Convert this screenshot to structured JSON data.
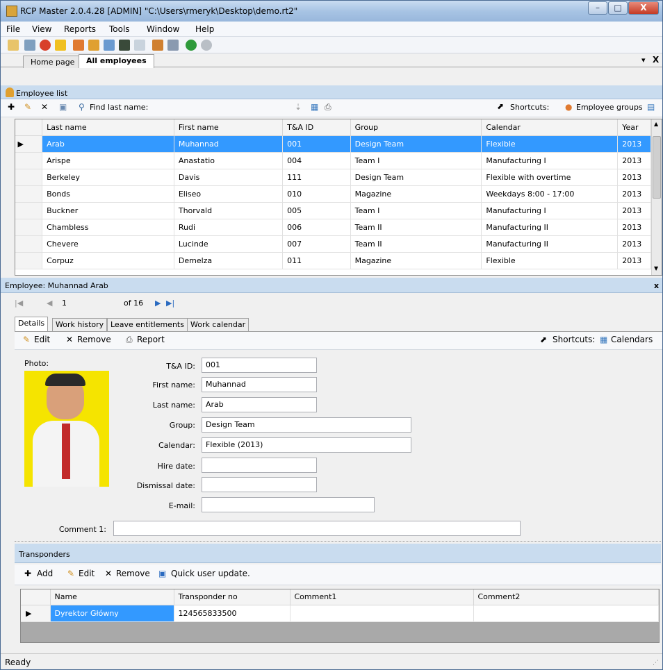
{
  "window": {
    "title": "RCP Master 2.0.4.28  [ADMIN] \"C:\\Users\\rmeryk\\Desktop\\demo.rt2\"",
    "minimize": "–",
    "maximize": "□",
    "close": "X"
  },
  "menu": [
    "File",
    "View",
    "Reports",
    "Tools",
    "Window",
    "Help"
  ],
  "page_tabs": {
    "home": "Home page",
    "active": "All employees",
    "pin": "▾",
    "close": "X"
  },
  "employee_list": {
    "header": "Employee list",
    "find_label": "Find last name:",
    "shortcuts_label": "Shortcuts:",
    "shortcut_link": "Employee groups",
    "columns": [
      "Last name",
      "First name",
      "T&A ID",
      "Group",
      "Calendar",
      "Year"
    ],
    "rows": [
      [
        "Arab",
        "Muhannad",
        "001",
        "Design Team",
        "Flexible",
        "2013"
      ],
      [
        "Arispe",
        "Anastatio",
        "004",
        "Team I",
        "Manufacturing I",
        "2013"
      ],
      [
        "Berkeley",
        "Davis",
        "111",
        "Design Team",
        "Flexible with overtime",
        "2013"
      ],
      [
        "Bonds",
        "Eliseo",
        "010",
        "Magazine",
        "Weekdays 8:00 - 17:00",
        "2013"
      ],
      [
        "Buckner",
        "Thorvald",
        "005",
        "Team I",
        "Manufacturing I",
        "2013"
      ],
      [
        "Chambless",
        "Rudi",
        "006",
        "Team II",
        "Manufacturing II",
        "2013"
      ],
      [
        "Chevere",
        "Lucinde",
        "007",
        "Team II",
        "Manufacturing II",
        "2013"
      ],
      [
        "Corpuz",
        "Demelza",
        "011",
        "Magazine",
        "Flexible",
        "2013"
      ]
    ]
  },
  "employee_detail": {
    "header": "Employee: Muhannad Arab",
    "close": "x",
    "nav_position": "1",
    "nav_total": "of 16",
    "tabs": [
      "Details",
      "Work history",
      "Leave entitlements",
      "Work calendar"
    ],
    "toolbar": {
      "edit": "Edit",
      "remove": "Remove",
      "report": "Report",
      "shortcuts": "Shortcuts:",
      "calendars": "Calendars"
    },
    "photo_label": "Photo:",
    "fields": {
      "ta_id_label": "T&A ID:",
      "ta_id": "001",
      "first_label": "First name:",
      "first": "Muhannad",
      "last_label": "Last name:",
      "last": "Arab",
      "group_label": "Group:",
      "group": "Design Team",
      "calendar_label": "Calendar:",
      "calendar": "Flexible  (2013)",
      "hire_label": "Hire date:",
      "hire": "",
      "dismissal_label": "Dismissal date:",
      "dismissal": "",
      "email_label": "E-mail:",
      "email": "",
      "comment_label": "Comment 1:",
      "comment": ""
    }
  },
  "transponders": {
    "header": "Transponders",
    "toolbar": {
      "add": "Add",
      "edit": "Edit",
      "remove": "Remove",
      "quick": "Quick user update."
    },
    "columns": [
      "Name",
      "Transponder no",
      "Comment1",
      "Comment2"
    ],
    "rows": [
      [
        "Dyrektor Główny",
        "124565833500",
        "",
        ""
      ]
    ]
  },
  "status": "Ready"
}
